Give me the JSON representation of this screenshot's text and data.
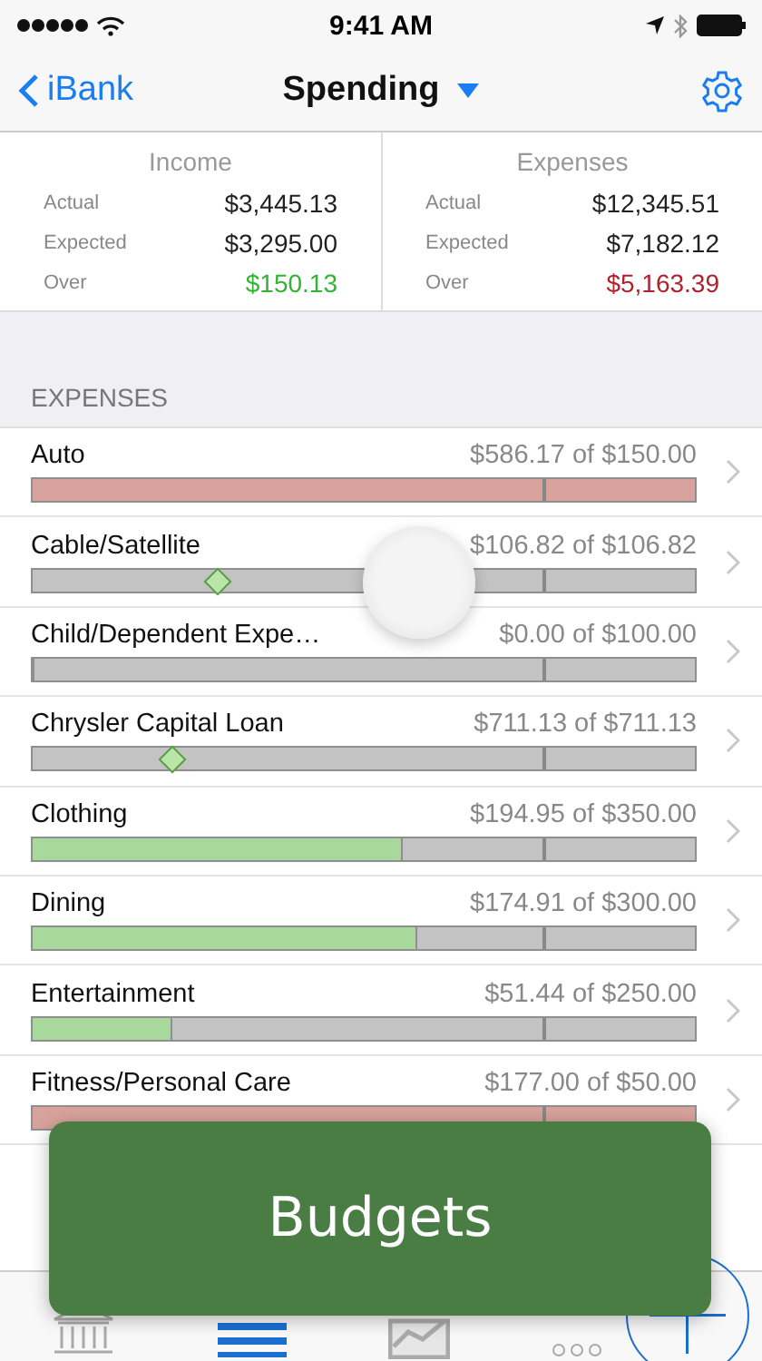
{
  "status_bar": {
    "time": "9:41 AM"
  },
  "nav": {
    "back": "iBank",
    "title": "Spending"
  },
  "summary": [
    {
      "title": "Income",
      "rows": [
        {
          "label": "Actual",
          "value": "$3,445.13",
          "kind": "plain"
        },
        {
          "label": "Expected",
          "value": "$3,295.00",
          "kind": "plain"
        },
        {
          "label": "Over",
          "value": "$150.13",
          "kind": "good"
        }
      ]
    },
    {
      "title": "Expenses",
      "rows": [
        {
          "label": "Actual",
          "value": "$12,345.51",
          "kind": "plain"
        },
        {
          "label": "Expected",
          "value": "$7,182.12",
          "kind": "plain"
        },
        {
          "label": "Over",
          "value": "$5,163.39",
          "kind": "bad"
        }
      ]
    }
  ],
  "section": "EXPENSES",
  "budgets": [
    {
      "name": "Auto",
      "amount": "$586.17 of $150.00",
      "kind": "over",
      "level": 1
    },
    {
      "name": "Cable/Satellite",
      "amount": "$106.82 of $106.82",
      "kind": "marker",
      "level": 0.28
    },
    {
      "name": "Child/Dependent Expe…",
      "amount": "$0.00 of $100.00",
      "kind": "under",
      "level": 0
    },
    {
      "name": "Chrysler Capital Loan",
      "amount": "$711.13 of $711.13",
      "kind": "marker",
      "level": 0.21
    },
    {
      "name": "Clothing",
      "amount": "$194.95 of $350.00",
      "kind": "under",
      "level": 0.56
    },
    {
      "name": "Dining",
      "amount": "$174.91 of $300.00",
      "kind": "under",
      "level": 0.58
    },
    {
      "name": "Entertainment",
      "amount": "$51.44 of $250.00",
      "kind": "under",
      "level": 0.21
    },
    {
      "name": "Fitness/Personal Care",
      "amount": "$177.00 of $50.00",
      "kind": "over",
      "level": 1
    }
  ],
  "tabs": [
    {
      "selected": false
    },
    {
      "selected": true
    },
    {
      "selected": false
    },
    {
      "selected": false
    }
  ],
  "overlay": {
    "label": "Budgets"
  }
}
